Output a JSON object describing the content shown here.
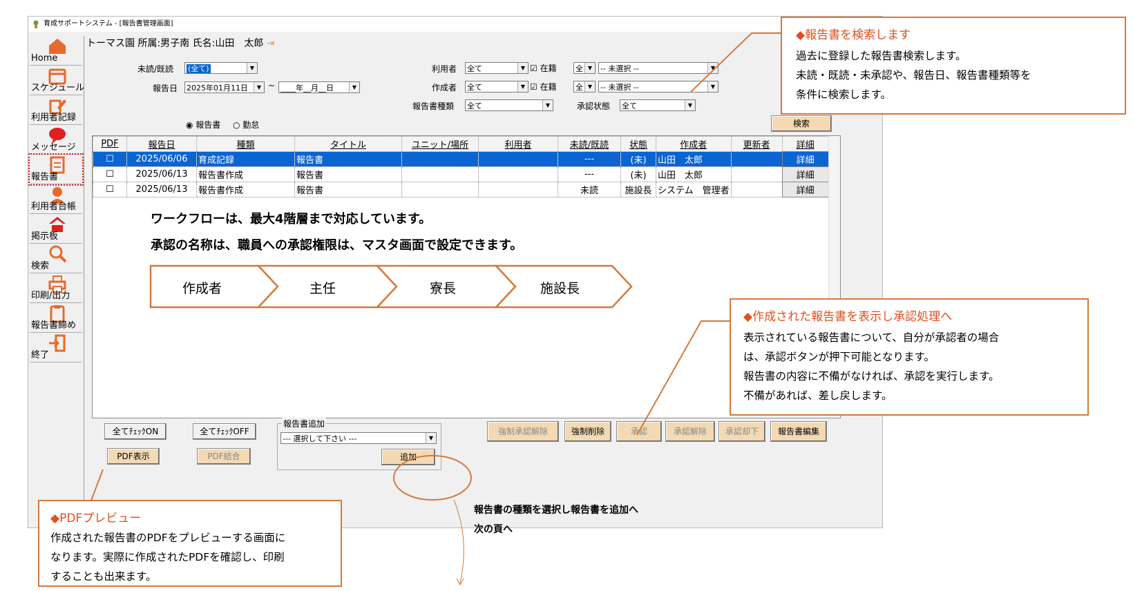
{
  "window": {
    "title": "育成サポートシステム - [報告書管理画面]"
  },
  "user_bar": {
    "text": "トーマス園 所属:男子南 氏名:山田　太郎"
  },
  "sidebar": {
    "items": [
      {
        "label": "Home",
        "icon": "home-icon"
      },
      {
        "label": "スケジュール",
        "icon": "calendar-icon"
      },
      {
        "label": "利用者記録",
        "icon": "pencil-icon"
      },
      {
        "label": "メッセージ",
        "icon": "message-icon"
      },
      {
        "label": "報告書",
        "icon": "document-icon"
      },
      {
        "label": "利用者台帳",
        "icon": "person-icon"
      },
      {
        "label": "掲示板",
        "icon": "bulletin-icon"
      },
      {
        "label": "検索",
        "icon": "search-icon"
      },
      {
        "label": "印刷/出力",
        "icon": "printer-icon"
      },
      {
        "label": "報告書締め",
        "icon": "clipboard-icon"
      },
      {
        "label": "終了",
        "icon": "exit-icon"
      }
    ]
  },
  "filters": {
    "read_label": "未読/既読",
    "read_value": "(全て)",
    "date_label": "報告日",
    "date_from": "2025年01月11日",
    "tilde": "~",
    "date_to": "____年__月__日",
    "user_label": "利用者",
    "user_value": "全て",
    "user_enrolled": "☑ 在籍",
    "user_scope": "全",
    "user_select": "-- 未選択 --",
    "author_label": "作成者",
    "author_value": "全て",
    "author_enrolled": "☑ 在籍",
    "author_scope": "全",
    "author_select": "-- 未選択 --",
    "type_label": "報告書種類",
    "type_value": "全て",
    "approval_label": "承認状態",
    "approval_value": "全て",
    "radio_report": "◉ 報告書",
    "radio_attendance": "○ 勤怠",
    "search_button": "検索"
  },
  "table": {
    "columns": [
      "PDF",
      "報告日",
      "種類",
      "タイトル",
      "ユニット/場所",
      "利用者",
      "未読/既読",
      "状態",
      "作成者",
      "更新者",
      "詳細"
    ],
    "rows": [
      {
        "pdf": "☐",
        "date": "2025/06/06",
        "kind": "育成記録",
        "title": "報告書",
        "unit": "",
        "user": "",
        "read": "---",
        "state": "(未)",
        "author": "山田　太郎",
        "updater": "",
        "detail": "詳細"
      },
      {
        "pdf": "☐",
        "date": "2025/06/13",
        "kind": "報告書作成",
        "title": "報告書",
        "unit": "",
        "user": "",
        "read": "---",
        "state": "(未)",
        "author": "山田　太郎",
        "updater": "",
        "detail": "詳細"
      },
      {
        "pdf": "☐",
        "date": "2025/06/13",
        "kind": "報告書作成",
        "title": "報告書",
        "unit": "",
        "user": "",
        "read": "未読",
        "state": "施設長",
        "author": "システム　管理者",
        "updater": "",
        "detail": "詳細"
      }
    ]
  },
  "workflow": {
    "line1": "ワークフローは、最大4階層まで対応しています。",
    "line2": "承認の名称は、職員への承認権限は、マスタ画面で設定できます。",
    "steps": [
      "作成者",
      "主任",
      "寮長",
      "施設長"
    ]
  },
  "bottom": {
    "check_on": "全てﾁｪｯｸON",
    "check_off": "全てﾁｪｯｸOFF",
    "pdf_show": "PDF表示",
    "pdf_merge": "PDF結合",
    "add_group": "報告書追加",
    "add_select": "--- 選択して下さい ---",
    "add_button": "追加",
    "force_unapprove": "強制承認解除",
    "force_delete": "強制削除",
    "approve": "承認",
    "unapprove": "承認解除",
    "reject": "承認却下",
    "edit": "報告書編集"
  },
  "callouts": {
    "search": {
      "title": "◆報告書を検索します",
      "lines": [
        "過去に登録した報告書検索します。",
        "未読・既読・未承認や、報告日、報告書種類等を",
        "条件に検索します。"
      ]
    },
    "approve": {
      "title": "◆作成された報告書を表示し承認処理へ",
      "lines": [
        "表示されている報告書について、自分が承認者の場合",
        "は、承認ボタンが押下可能となります。",
        "報告書の内容に不備がなければ、承認を実行します。",
        "不備があれば、差し戻します。"
      ]
    },
    "pdf": {
      "title": "◆PDFプレビュー",
      "lines": [
        "作成された報告書のPDFをプレビューする画面に",
        "なります。実際に作成されたPDFを確認し、印刷",
        "することも出来ます。"
      ]
    }
  },
  "notes": {
    "add_note": "報告書の種類を選択し報告書を追加へ",
    "next_page": "次の頁へ"
  },
  "colors": {
    "accent": "#d4793a",
    "callout_title": "#e24f1b",
    "selection": "#0a64d2",
    "button_tan": "#f3d9b4"
  }
}
